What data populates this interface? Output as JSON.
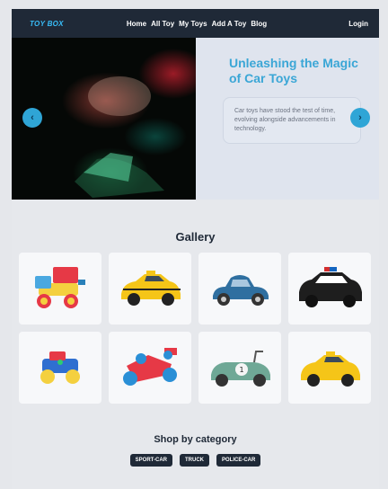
{
  "nav": {
    "logo": "TOY BOX",
    "links": [
      "Home",
      "All Toy",
      "My Toys",
      "Add A Toy",
      "Blog"
    ],
    "login": "Login"
  },
  "hero": {
    "title": "Unleashing the Magic of Car Toys",
    "description": "Car toys have stood the test of time, evolving alongside advancements in technology.",
    "prev_icon": "chevron-left-icon",
    "next_icon": "chevron-right-icon"
  },
  "gallery": {
    "title": "Gallery",
    "items": [
      "dump-truck-toy",
      "yellow-taxi",
      "blue-vintage-car",
      "police-car",
      "blue-toy-car",
      "red-race-car",
      "green-racer-car",
      "yellow-taxi-2"
    ]
  },
  "category": {
    "title": "Shop by category",
    "tabs": [
      "SPORT-CAR",
      "TRUCK",
      "POLICE-CAR"
    ]
  },
  "colors": {
    "nav_bg": "#1f2937",
    "accent": "#2fa5d6",
    "logo": "#38bdf8"
  }
}
